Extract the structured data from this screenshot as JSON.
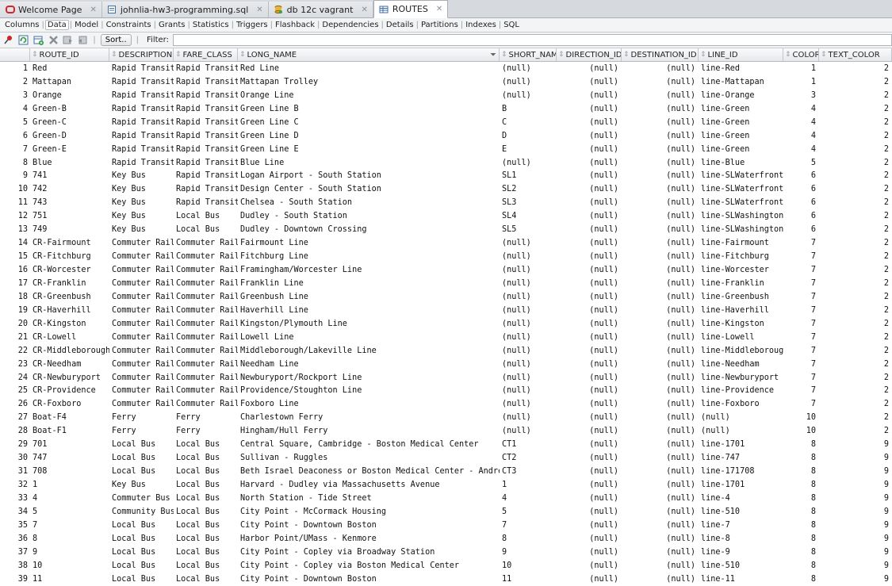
{
  "tabs": [
    {
      "label": "Welcome Page",
      "icon": "oracle-icon",
      "active": false
    },
    {
      "label": "johnlia-hw3-programming.sql",
      "icon": "sql-file-icon",
      "active": false
    },
    {
      "label": "db 12c vagrant",
      "icon": "database-connection-icon",
      "active": false
    },
    {
      "label": "ROUTES",
      "icon": "table-icon",
      "active": true
    }
  ],
  "subtabs": [
    "Columns",
    "Data",
    "Model",
    "Constraints",
    "Grants",
    "Statistics",
    "Triggers",
    "Flashback",
    "Dependencies",
    "Details",
    "Partitions",
    "Indexes",
    "SQL"
  ],
  "active_subtab": "Data",
  "toolbar": {
    "icons": [
      "pin-icon",
      "refresh-icon",
      "insert-row-icon",
      "delete-row-icon",
      "commit-icon",
      "rollback-icon"
    ],
    "sort_label": "Sort..",
    "filter_label": "Filter:",
    "filter_value": ""
  },
  "columns": [
    "",
    "ROUTE_ID",
    "DESCRIPTION",
    "FARE_CLASS",
    "LONG_NAME",
    "SHORT_NAME",
    "DIRECTION_ID",
    "DESTINATION_ID",
    "LINE_ID",
    "COLOR",
    "TEXT_COLOR"
  ],
  "rows": [
    [
      "1",
      "Red",
      "Rapid Transit",
      "Rapid Transit",
      "Red Line",
      "(null)",
      "(null)",
      "(null)",
      "line-Red",
      "1",
      "2"
    ],
    [
      "2",
      "Mattapan",
      "Rapid Transit",
      "Rapid Transit",
      "Mattapan Trolley",
      "(null)",
      "(null)",
      "(null)",
      "line-Mattapan",
      "1",
      "2"
    ],
    [
      "3",
      "Orange",
      "Rapid Transit",
      "Rapid Transit",
      "Orange Line",
      "(null)",
      "(null)",
      "(null)",
      "line-Orange",
      "3",
      "2"
    ],
    [
      "4",
      "Green-B",
      "Rapid Transit",
      "Rapid Transit",
      "Green Line B",
      "B",
      "(null)",
      "(null)",
      "line-Green",
      "4",
      "2"
    ],
    [
      "5",
      "Green-C",
      "Rapid Transit",
      "Rapid Transit",
      "Green Line C",
      "C",
      "(null)",
      "(null)",
      "line-Green",
      "4",
      "2"
    ],
    [
      "6",
      "Green-D",
      "Rapid Transit",
      "Rapid Transit",
      "Green Line D",
      "D",
      "(null)",
      "(null)",
      "line-Green",
      "4",
      "2"
    ],
    [
      "7",
      "Green-E",
      "Rapid Transit",
      "Rapid Transit",
      "Green Line E",
      "E",
      "(null)",
      "(null)",
      "line-Green",
      "4",
      "2"
    ],
    [
      "8",
      "Blue",
      "Rapid Transit",
      "Rapid Transit",
      "Blue Line",
      "(null)",
      "(null)",
      "(null)",
      "line-Blue",
      "5",
      "2"
    ],
    [
      "9",
      "741",
      "Key Bus",
      "Rapid Transit",
      "Logan Airport - South Station",
      "SL1",
      "(null)",
      "(null)",
      "line-SLWaterfront",
      "6",
      "2"
    ],
    [
      "10",
      "742",
      "Key Bus",
      "Rapid Transit",
      "Design Center - South Station",
      "SL2",
      "(null)",
      "(null)",
      "line-SLWaterfront",
      "6",
      "2"
    ],
    [
      "11",
      "743",
      "Key Bus",
      "Rapid Transit",
      "Chelsea - South Station",
      "SL3",
      "(null)",
      "(null)",
      "line-SLWaterfront",
      "6",
      "2"
    ],
    [
      "12",
      "751",
      "Key Bus",
      "Local Bus",
      "Dudley - South Station",
      "SL4",
      "(null)",
      "(null)",
      "line-SLWashington",
      "6",
      "2"
    ],
    [
      "13",
      "749",
      "Key Bus",
      "Local Bus",
      "Dudley - Downtown Crossing",
      "SL5",
      "(null)",
      "(null)",
      "line-SLWashington",
      "6",
      "2"
    ],
    [
      "14",
      "CR-Fairmount",
      "Commuter Rail",
      "Commuter Rail",
      "Fairmount Line",
      "(null)",
      "(null)",
      "(null)",
      "line-Fairmount",
      "7",
      "2"
    ],
    [
      "15",
      "CR-Fitchburg",
      "Commuter Rail",
      "Commuter Rail",
      "Fitchburg Line",
      "(null)",
      "(null)",
      "(null)",
      "line-Fitchburg",
      "7",
      "2"
    ],
    [
      "16",
      "CR-Worcester",
      "Commuter Rail",
      "Commuter Rail",
      "Framingham/Worcester Line",
      "(null)",
      "(null)",
      "(null)",
      "line-Worcester",
      "7",
      "2"
    ],
    [
      "17",
      "CR-Franklin",
      "Commuter Rail",
      "Commuter Rail",
      "Franklin Line",
      "(null)",
      "(null)",
      "(null)",
      "line-Franklin",
      "7",
      "2"
    ],
    [
      "18",
      "CR-Greenbush",
      "Commuter Rail",
      "Commuter Rail",
      "Greenbush Line",
      "(null)",
      "(null)",
      "(null)",
      "line-Greenbush",
      "7",
      "2"
    ],
    [
      "19",
      "CR-Haverhill",
      "Commuter Rail",
      "Commuter Rail",
      "Haverhill Line",
      "(null)",
      "(null)",
      "(null)",
      "line-Haverhill",
      "7",
      "2"
    ],
    [
      "20",
      "CR-Kingston",
      "Commuter Rail",
      "Commuter Rail",
      "Kingston/Plymouth Line",
      "(null)",
      "(null)",
      "(null)",
      "line-Kingston",
      "7",
      "2"
    ],
    [
      "21",
      "CR-Lowell",
      "Commuter Rail",
      "Commuter Rail",
      "Lowell Line",
      "(null)",
      "(null)",
      "(null)",
      "line-Lowell",
      "7",
      "2"
    ],
    [
      "22",
      "CR-Middleborough",
      "Commuter Rail",
      "Commuter Rail",
      "Middleborough/Lakeville Line",
      "(null)",
      "(null)",
      "(null)",
      "line-Middleborough",
      "7",
      "2"
    ],
    [
      "23",
      "CR-Needham",
      "Commuter Rail",
      "Commuter Rail",
      "Needham Line",
      "(null)",
      "(null)",
      "(null)",
      "line-Needham",
      "7",
      "2"
    ],
    [
      "24",
      "CR-Newburyport",
      "Commuter Rail",
      "Commuter Rail",
      "Newburyport/Rockport Line",
      "(null)",
      "(null)",
      "(null)",
      "line-Newburyport",
      "7",
      "2"
    ],
    [
      "25",
      "CR-Providence",
      "Commuter Rail",
      "Commuter Rail",
      "Providence/Stoughton Line",
      "(null)",
      "(null)",
      "(null)",
      "line-Providence",
      "7",
      "2"
    ],
    [
      "26",
      "CR-Foxboro",
      "Commuter Rail",
      "Commuter Rail",
      "Foxboro Line",
      "(null)",
      "(null)",
      "(null)",
      "line-Foxboro",
      "7",
      "2"
    ],
    [
      "27",
      "Boat-F4",
      "Ferry",
      "Ferry",
      "Charlestown Ferry",
      "(null)",
      "(null)",
      "(null)",
      "(null)",
      "10",
      "2"
    ],
    [
      "28",
      "Boat-F1",
      "Ferry",
      "Ferry",
      "Hingham/Hull Ferry",
      "(null)",
      "(null)",
      "(null)",
      "(null)",
      "10",
      "2"
    ],
    [
      "29",
      "701",
      "Local Bus",
      "Local Bus",
      "Central Square, Cambridge - Boston Medical Center",
      "CT1",
      "(null)",
      "(null)",
      "line-1701",
      "8",
      "9"
    ],
    [
      "30",
      "747",
      "Local Bus",
      "Local Bus",
      "Sullivan - Ruggles",
      "CT2",
      "(null)",
      "(null)",
      "line-747",
      "8",
      "9"
    ],
    [
      "31",
      "708",
      "Local Bus",
      "Local Bus",
      "Beth Israel Deaconess or Boston Medical Center - Andrew",
      "CT3",
      "(null)",
      "(null)",
      "line-171708",
      "8",
      "9"
    ],
    [
      "32",
      "1",
      "Key Bus",
      "Local Bus",
      "Harvard - Dudley via Massachusetts Avenue",
      "1",
      "(null)",
      "(null)",
      "line-1701",
      "8",
      "9"
    ],
    [
      "33",
      "4",
      "Commuter Bus",
      "Local Bus",
      "North Station - Tide Street",
      "4",
      "(null)",
      "(null)",
      "line-4",
      "8",
      "9"
    ],
    [
      "34",
      "5",
      "Community Bus",
      "Local Bus",
      "City Point - McCormack Housing",
      "5",
      "(null)",
      "(null)",
      "line-510",
      "8",
      "9"
    ],
    [
      "35",
      "7",
      "Local Bus",
      "Local Bus",
      "City Point - Downtown Boston",
      "7",
      "(null)",
      "(null)",
      "line-7",
      "8",
      "9"
    ],
    [
      "36",
      "8",
      "Local Bus",
      "Local Bus",
      "Harbor Point/UMass - Kenmore",
      "8",
      "(null)",
      "(null)",
      "line-8",
      "8",
      "9"
    ],
    [
      "37",
      "9",
      "Local Bus",
      "Local Bus",
      "City Point - Copley via Broadway Station",
      "9",
      "(null)",
      "(null)",
      "line-9",
      "8",
      "9"
    ],
    [
      "38",
      "10",
      "Local Bus",
      "Local Bus",
      "City Point - Copley via Boston Medical Center",
      "10",
      "(null)",
      "(null)",
      "line-510",
      "8",
      "9"
    ],
    [
      "39",
      "11",
      "Local Bus",
      "Local Bus",
      "City Point - Downtown Boston",
      "11",
      "(null)",
      "(null)",
      "line-11",
      "8",
      "9"
    ]
  ]
}
